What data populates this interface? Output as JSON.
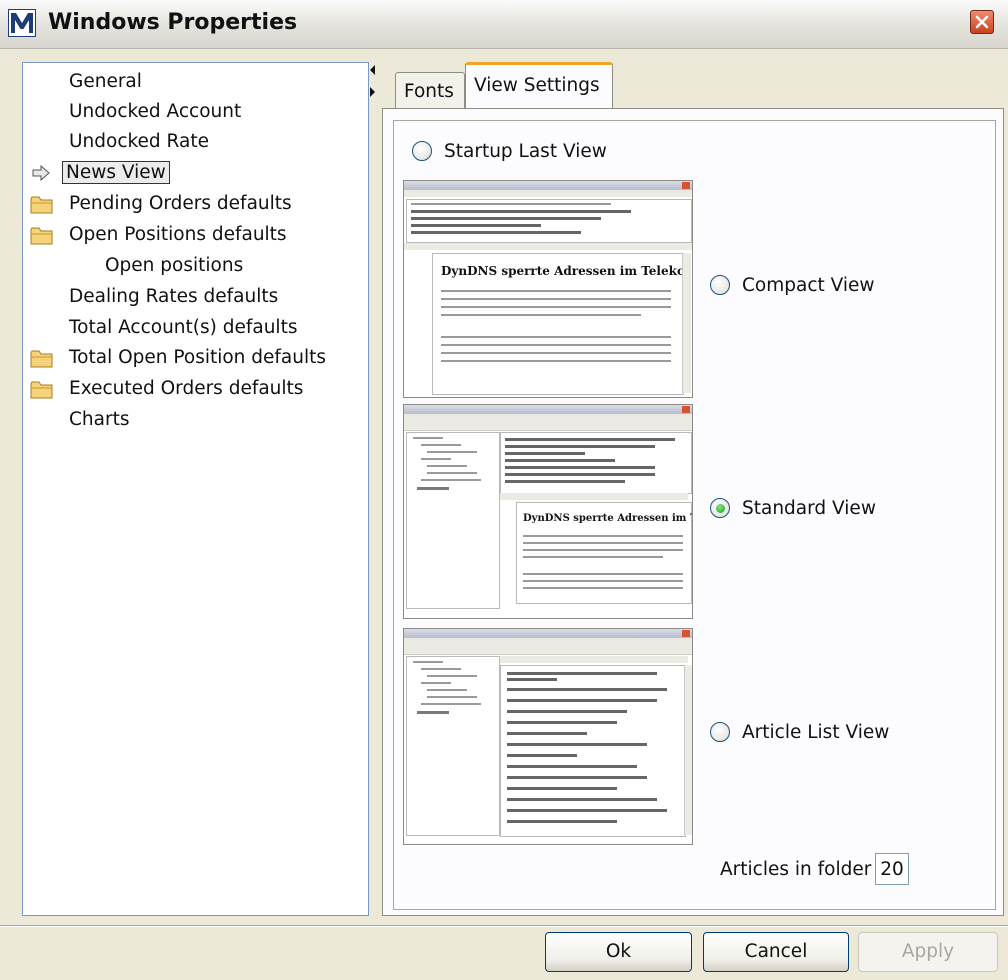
{
  "window": {
    "title": "Windows Properties",
    "close_icon": "close-icon"
  },
  "tree": {
    "items": [
      {
        "label": "General"
      },
      {
        "label": "Undocked Account"
      },
      {
        "label": "Undocked Rate"
      },
      {
        "label": "News View",
        "selected": true,
        "icon": "arrow-icon"
      },
      {
        "label": "Pending Orders defaults",
        "icon": "folder-icon"
      },
      {
        "label": "Open Positions defaults",
        "icon": "folder-icon"
      },
      {
        "label": "Open positions"
      },
      {
        "label": "Dealing Rates defaults"
      },
      {
        "label": "Total Account(s) defaults"
      },
      {
        "label": "Total Open Position defaults",
        "icon": "folder-icon"
      },
      {
        "label": "Executed Orders defaults",
        "icon": "folder-icon"
      },
      {
        "label": "Charts"
      }
    ]
  },
  "tabs": [
    {
      "label": "Fonts",
      "active": false
    },
    {
      "label": "View Settings",
      "active": true
    }
  ],
  "view_settings": {
    "options": [
      {
        "label": "Startup Last View",
        "checked": false
      },
      {
        "label": "Compact View",
        "checked": false
      },
      {
        "label": "Standard View",
        "checked": true
      },
      {
        "label": "Article List View",
        "checked": false
      }
    ],
    "articles_label": "Articles in folder",
    "articles_value": "20",
    "preview_headline": "DynDNS sperrte Adressen im Teleko",
    "preview_headline_2": "DynDNS sperrte Adressen im Telekom"
  },
  "buttons": {
    "ok": "Ok",
    "cancel": "Cancel",
    "apply": "Apply"
  },
  "colors": {
    "tab_accent": "#f0a52a",
    "selected_radio": "#21a121",
    "tree_border": "#7a98c6"
  }
}
